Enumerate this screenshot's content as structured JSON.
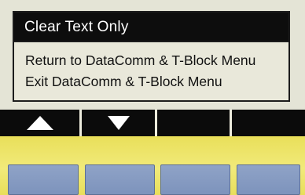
{
  "screen": {
    "title": "Clear Text Only",
    "menu_items": [
      {
        "label": "Return to DataComm & T-Block Menu"
      },
      {
        "label": "Exit DataComm & T-Block Menu"
      }
    ]
  },
  "softkeys": [
    {
      "icon": "up-arrow-icon"
    },
    {
      "icon": "down-arrow-icon"
    },
    {
      "icon": ""
    },
    {
      "icon": ""
    }
  ],
  "colors": {
    "title_bar": "#0d0d0d",
    "lcd_background": "#e9e8da",
    "softkey_strip": "#0b0b0b",
    "panel_yellow": "#ece36a",
    "button_blue": "#8599c2"
  }
}
